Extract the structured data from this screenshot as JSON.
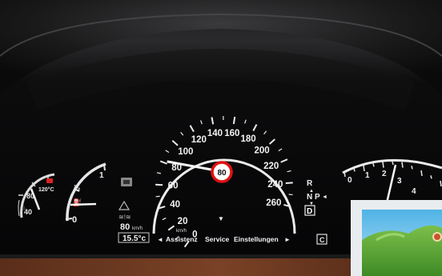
{
  "speedometer": {
    "major_ticks": [
      "0",
      "20",
      "40",
      "60",
      "80",
      "100",
      "120",
      "140",
      "160",
      "180",
      "200",
      "220",
      "240",
      "260"
    ],
    "unit": "km/h",
    "limit_sign": "80",
    "needle_kmh": 82
  },
  "fuel_gauge": {
    "labels": [
      "0",
      "½",
      "1"
    ],
    "level_fraction": 0.28
  },
  "temp_gauge": {
    "labels": [
      "40",
      "80",
      "120°C"
    ],
    "value_c": 80
  },
  "tachometer": {
    "labels": [
      "0",
      "1",
      "2",
      "3",
      "4"
    ],
    "needle_rpm_x1000": 2.2
  },
  "menu": {
    "left_arrow": "◄",
    "items": [
      "Assistenz",
      "Service",
      "Einstellungen"
    ],
    "right_arrow": "►"
  },
  "distronic": {
    "set_speed": "80",
    "set_speed_unit": "km/h"
  },
  "outside_temp": "15.5°c",
  "gear": {
    "options": [
      "R",
      "N",
      "P",
      "D"
    ],
    "selected": "D",
    "pointer": "◄"
  },
  "mode_badge": "C",
  "center_marker": "▼"
}
